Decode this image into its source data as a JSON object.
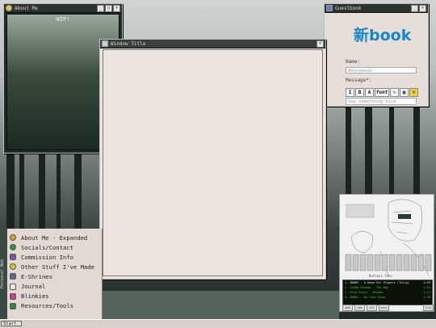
{
  "about_window": {
    "title": "About Me",
    "content": "WIP!"
  },
  "main_window": {
    "title": "Window Title"
  },
  "guestbook": {
    "title": "Guestbook",
    "logo": "新book",
    "name_label": "Name:",
    "name_placeholder": "Anonymous",
    "message_label": "Message*:",
    "message_placeholder": "Say something nice",
    "format_tools": [
      "I",
      "B",
      "A",
      "font",
      "✎",
      "▣",
      "☺"
    ]
  },
  "start_menu": {
    "stripe_text": "Personal Web",
    "items": [
      {
        "label": "About Me - Expanded",
        "color": "#d9a21e"
      },
      {
        "label": "Socials/Contact",
        "color": "#3a8a4a"
      },
      {
        "label": "Commission Info",
        "color": "#8a4fb0"
      },
      {
        "label": "Other Stuff I've Made",
        "color": "#e0c23a"
      },
      {
        "label": "E-Shrines",
        "color": "#5a6e88"
      },
      {
        "label": "Journal",
        "color": "#e8e8e8"
      },
      {
        "label": "Blinkies",
        "color": "#d63a8a"
      },
      {
        "label": "Resources/Tools",
        "color": "#2f8a3a"
      }
    ]
  },
  "taskbar": {
    "start_label": "Start"
  },
  "player": {
    "now_playing": "Buttons Tabs",
    "playlist": [
      {
        "title": "1. OMORI - A Home For Flowers (Tulip)",
        "time": "1:59"
      },
      {
        "title": "2. Vidéo Blonde - The Way",
        "time": "3:55"
      },
      {
        "title": "3. Erik Satie - Blonde",
        "time": "4:11"
      },
      {
        "title": "4. OMORI - By Your Side",
        "time": "1:38"
      }
    ],
    "buttons": [
      "add",
      "rem",
      "sel",
      "misc",
      "list"
    ]
  }
}
